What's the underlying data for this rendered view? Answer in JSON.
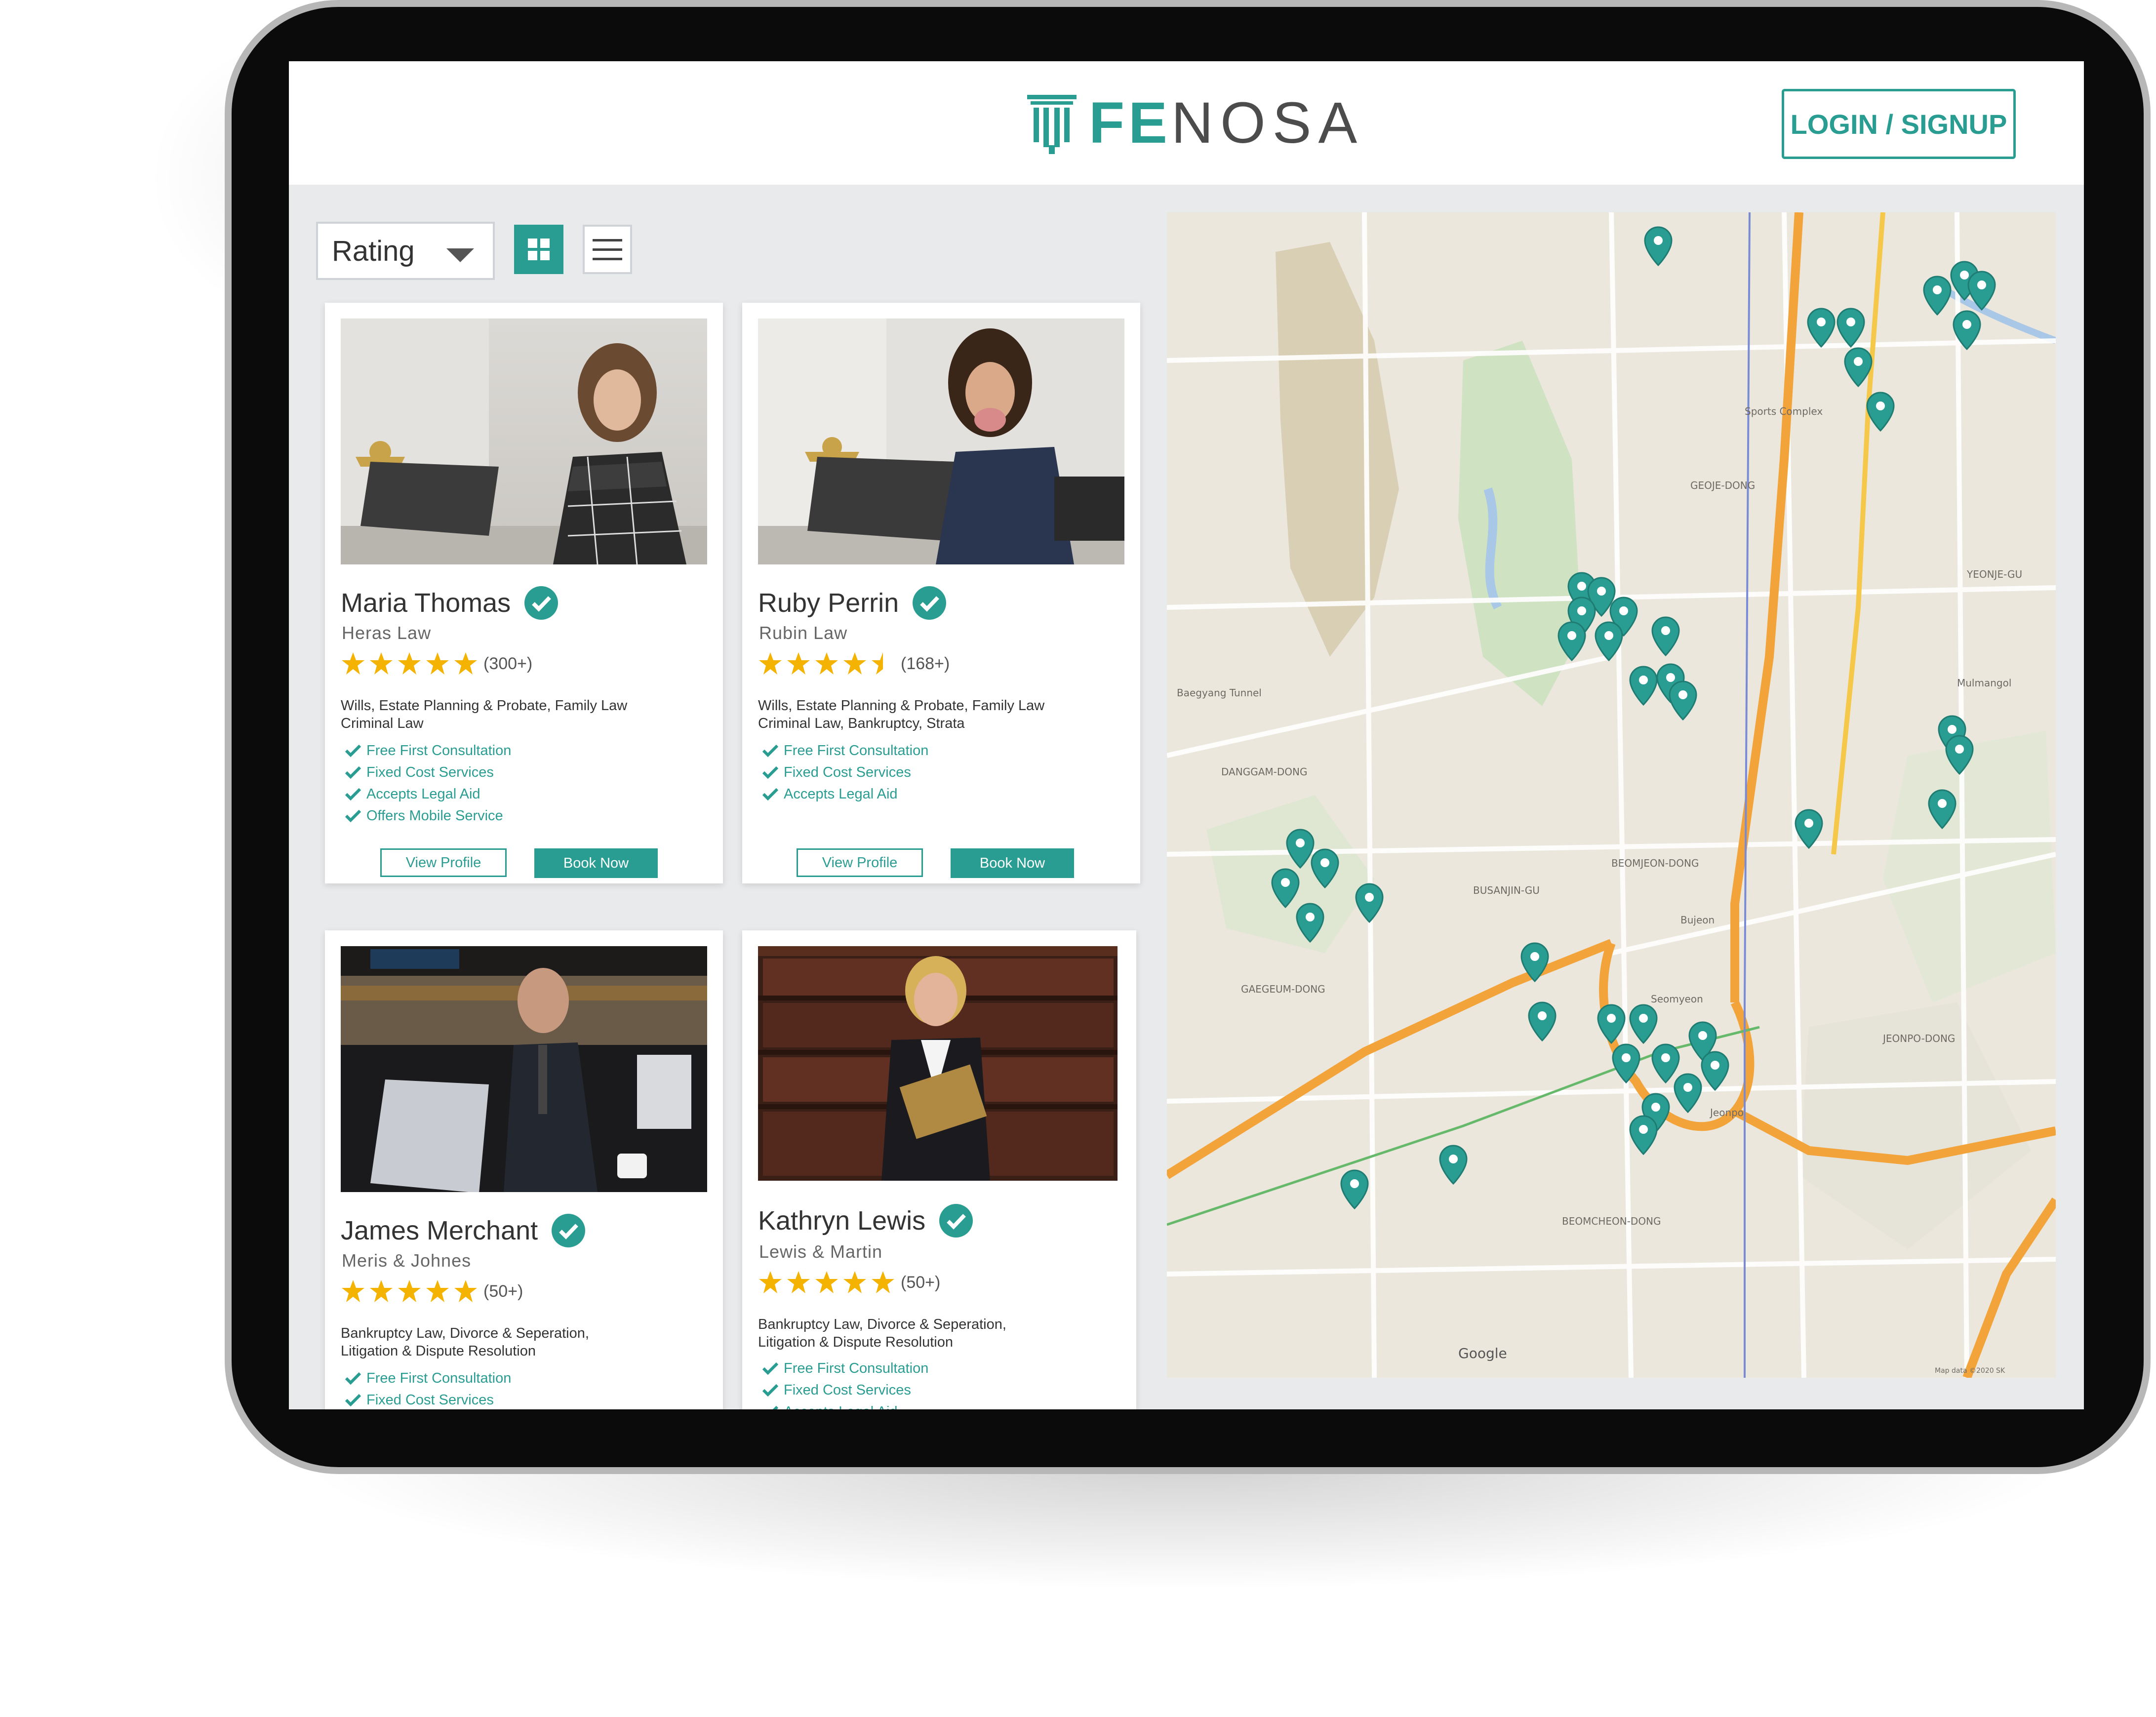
{
  "header": {
    "logo_part1": "FE",
    "logo_part2": "NOSA",
    "login_label": "LOGIN / SIGNUP"
  },
  "toolbar": {
    "sort_value": "Rating",
    "grid_view_icon": "grid-icon",
    "list_view_icon": "list-icon"
  },
  "lawyers": [
    {
      "name": "Maria Thomas",
      "firm": "Heras Law",
      "rating": 5,
      "rating_count": "(300+)",
      "areas_line1": "Wills, Estate Planning & Probate, Family Law",
      "areas_line2": "Criminal Law",
      "features": [
        "Free First Consultation",
        "Fixed Cost Services",
        "Accepts Legal Aid",
        "Offers Mobile Service"
      ],
      "view_label": "View Profile",
      "book_label": "Book Now"
    },
    {
      "name": "Ruby Perrin",
      "firm": "Rubin Law",
      "rating": 4.5,
      "rating_count": "(168+)",
      "areas_line1": "Wills, Estate Planning & Probate, Family Law",
      "areas_line2": "Criminal Law, Bankruptcy, Strata",
      "features": [
        "Free First Consultation",
        "Fixed Cost Services",
        "Accepts Legal Aid"
      ],
      "view_label": "View Profile",
      "book_label": "Book Now"
    },
    {
      "name": "James Merchant",
      "firm": "Meris & Johnes",
      "rating": 5,
      "rating_count": "(50+)",
      "areas_line1": "Bankruptcy Law, Divorce & Seperation,",
      "areas_line2": "Litigation & Dispute Resolution",
      "features": [
        "Free First Consultation",
        "Fixed Cost Services"
      ]
    },
    {
      "name": "Kathryn Lewis",
      "firm": "Lewis & Martin",
      "rating": 5,
      "rating_count": "(50+)",
      "areas_line1": "Bankruptcy Law, Divorce & Seperation,",
      "areas_line2": "Litigation & Dispute Resolution",
      "features": [
        "Free First Consultation",
        "Fixed Cost Services",
        "Accepts Legal Aid"
      ]
    }
  ],
  "map": {
    "labels": [
      "DANGGAM-DONG",
      "GEOJE-DONG",
      "YEONJE-GU",
      "BUSANJIN-GU",
      "BEOMJEON-DONG",
      "JEONPO-DONG",
      "BEOMCHEON-DONG",
      "GAEGEUM-DONG",
      "Seomyeon",
      "Jeonpo",
      "Bujeon",
      "Sports Complex",
      "Mulmangol",
      "Baegyang Tunnel",
      "Google"
    ],
    "attribution": "Map data ©2020 SK",
    "pin_color": "#2a9d92",
    "pin_icon": "map-pin-icon"
  },
  "colors": {
    "accent": "#2a9d92",
    "star": "#f5b301"
  }
}
